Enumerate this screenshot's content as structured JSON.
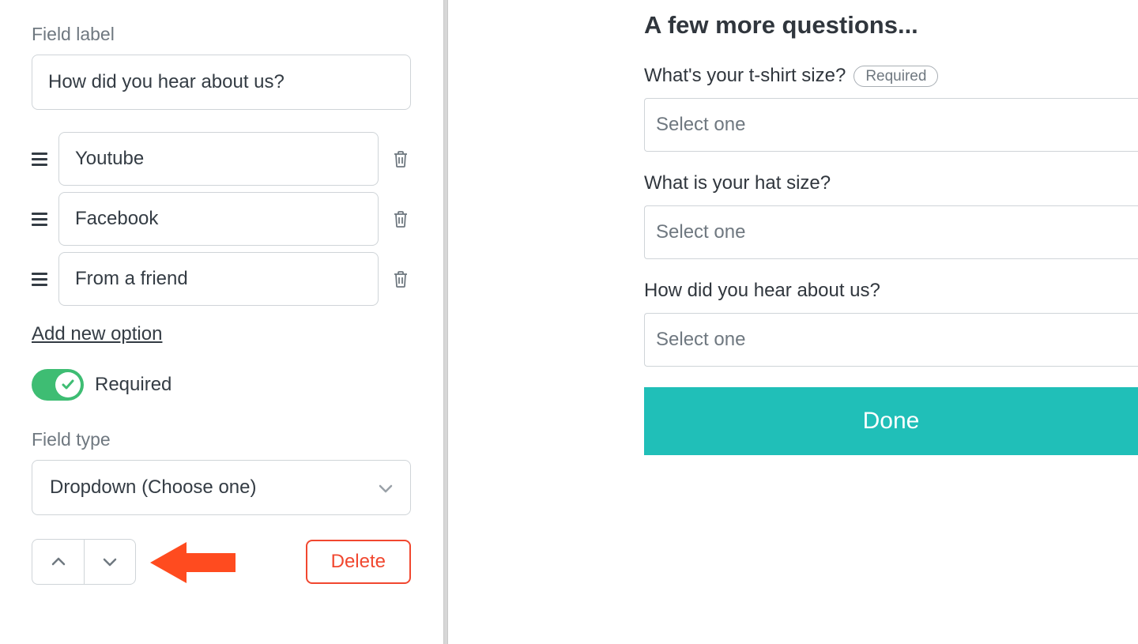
{
  "editor": {
    "field_label_caption": "Field label",
    "field_label_value": "How did you hear about us?",
    "options": [
      {
        "value": "Youtube"
      },
      {
        "value": "Facebook"
      },
      {
        "value": "From a friend"
      }
    ],
    "add_option_label": "Add new option",
    "required_toggle_label": "Required",
    "field_type_caption": "Field type",
    "field_type_value": "Dropdown (Choose one)",
    "delete_label": "Delete"
  },
  "preview": {
    "heading": "A few more questions...",
    "required_badge": "Required",
    "placeholder": "Select one",
    "fields": [
      {
        "label": "What's your t-shirt size?",
        "required": true
      },
      {
        "label": "What is your hat size?",
        "required": false
      },
      {
        "label": "How did you hear about us?",
        "required": false
      }
    ],
    "submit_label": "Done"
  },
  "colors": {
    "accent_green": "#3ebd73",
    "accent_teal": "#20bfb8",
    "danger": "#f1472f",
    "annotation_orange": "#ff4b1f"
  }
}
